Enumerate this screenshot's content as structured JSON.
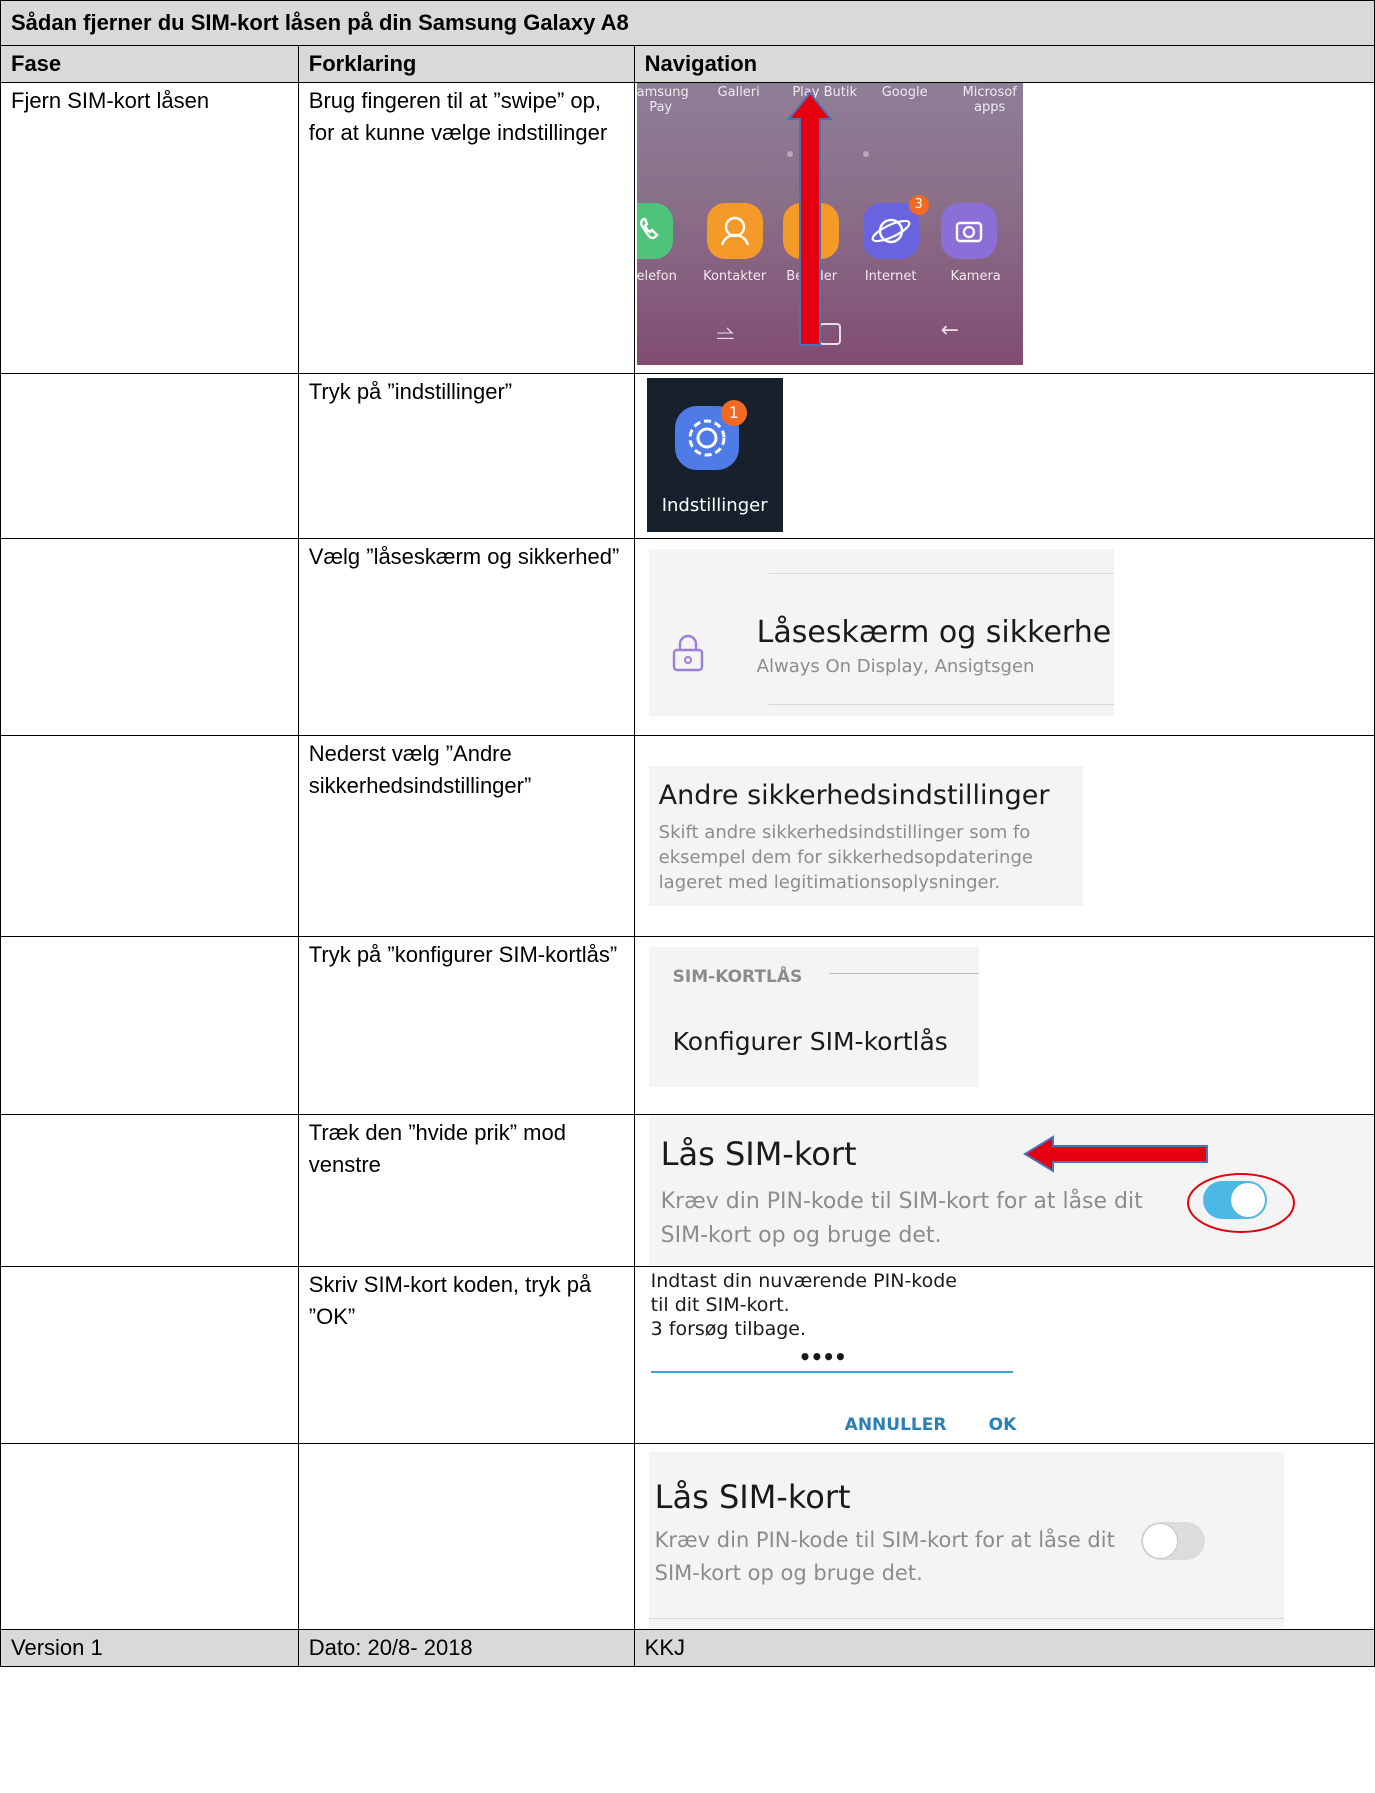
{
  "title": "Sådan fjerner du SIM-kort låsen på din Samsung Galaxy A8",
  "headers": {
    "phase": "Fase",
    "explanation": "Forklaring",
    "navigation": "Navigation"
  },
  "rows": [
    {
      "phase": "Fjern SIM-kort låsen",
      "explanation": "Brug fingeren til at ”swipe” op, for at kunne vælge indstillinger"
    },
    {
      "phase": "",
      "explanation": "Tryk på ”indstillinger”"
    },
    {
      "phase": "",
      "explanation": "Vælg ”låseskærm og sikkerhed”"
    },
    {
      "phase": "",
      "explanation": "Nederst vælg ”Andre sikkerhedsindstillinger”"
    },
    {
      "phase": "",
      "explanation": "Tryk på ”konfigurer SIM-kortlås”"
    },
    {
      "phase": "",
      "explanation": "Træk den ”hvide prik” mod venstre"
    },
    {
      "phase": "",
      "explanation": "Skriv SIM-kort koden, tryk på ”OK”"
    },
    {
      "phase": "",
      "explanation": ""
    }
  ],
  "screens": {
    "home": {
      "top_labels": [
        "amsung\nPay",
        "Galleri",
        "Play Butik",
        "Google",
        "Microsof\napps"
      ],
      "app_labels": [
        "elefon",
        "Kontakter",
        "Be   der",
        "Internet",
        "Kamera"
      ],
      "internet_badge": "3"
    },
    "settings_icon": {
      "label": "Indstillinger",
      "badge": "1"
    },
    "lockscreen": {
      "title": "Låseskærm og sikkerhe",
      "subtitle": "Always On Display, Ansigtsgen"
    },
    "other_security": {
      "title": "Andre sikkerhedsindstillinger",
      "subtitle_lines": [
        "Skift andre sikkerhedsindstillinger som fo",
        "eksempel dem for sikkerhedsopdateringe",
        "lageret med legitimationsoplysninger."
      ]
    },
    "sim_lock_section": {
      "header": "SIM-KORTLÅS",
      "item": "Konfigurer SIM-kortlås"
    },
    "lock_sim_on": {
      "title": "Lås SIM-kort",
      "subtitle_lines": [
        "Kræv din PIN-kode til SIM-kort for at låse dit",
        "SIM-kort op og bruge det."
      ]
    },
    "pin_dialog": {
      "prompt_lines": [
        "Indtast din nuværende PIN-kode",
        "til dit SIM-kort.",
        "3 forsøg tilbage."
      ],
      "pin_value": "••••",
      "cancel": "ANNULLER",
      "ok": "OK"
    },
    "lock_sim_off": {
      "title": "Lås SIM-kort",
      "subtitle_lines": [
        "Kræv din PIN-kode til SIM-kort for at låse dit",
        "SIM-kort op og bruge det."
      ]
    }
  },
  "colors": {
    "header_bg": "#d9d9d9",
    "arrow_red": "#e3000f",
    "toggle_on": "#4bb8e6",
    "toggle_off": "#dcdcdc",
    "lock_icon": "#9c7fd9",
    "dialog_button": "#2a7fb3"
  },
  "footer": {
    "version": "Version 1",
    "date": "Dato: 20/8- 2018",
    "author": "KKJ"
  }
}
